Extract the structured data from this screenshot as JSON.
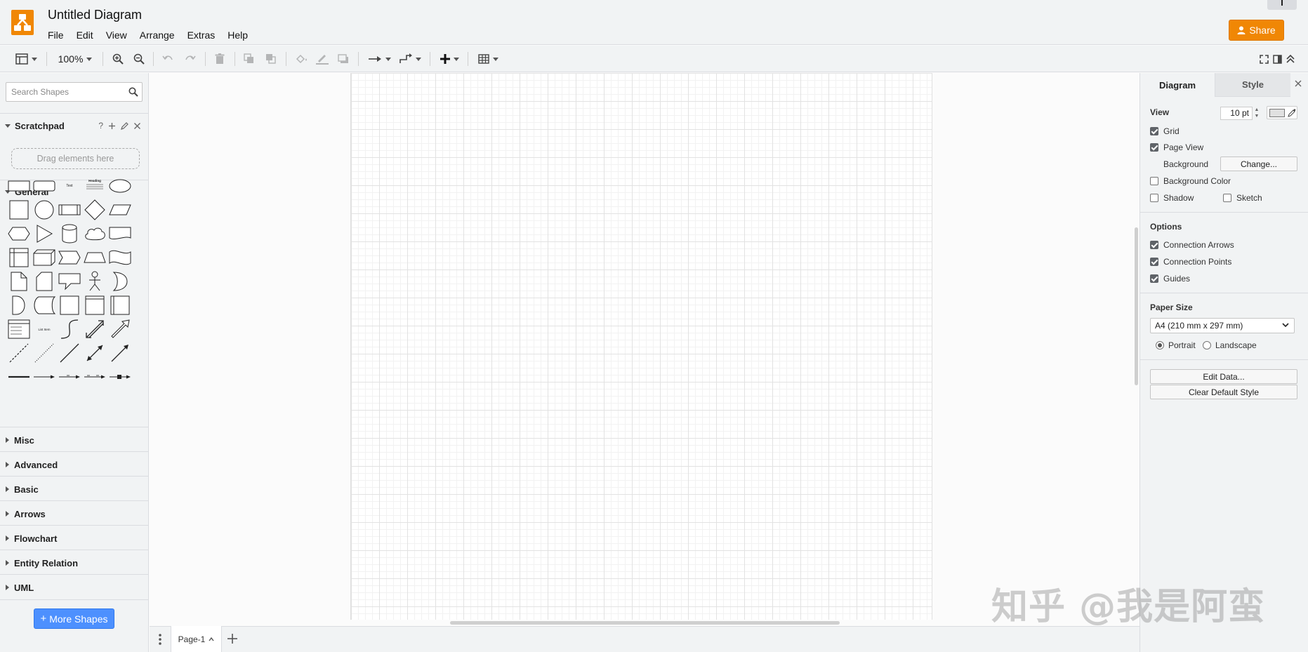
{
  "app": {
    "title": "Untitled Diagram",
    "share_label": "Share",
    "brand_color": "#f08705"
  },
  "menu": [
    "File",
    "Edit",
    "View",
    "Arrange",
    "Extras",
    "Help"
  ],
  "toolbar": {
    "zoom": "100%",
    "icons": [
      "view-icon",
      "zoom-in-icon",
      "zoom-out-icon",
      "undo-icon",
      "redo-icon",
      "delete-icon",
      "to-front-icon",
      "to-back-icon",
      "fill-color-icon",
      "line-color-icon",
      "shadow-icon",
      "connection-icon",
      "waypoints-icon",
      "insert-icon",
      "table-icon",
      "fullscreen-icon",
      "format-panel-icon",
      "collapse-icon"
    ]
  },
  "sidebar": {
    "search_placeholder": "Search Shapes",
    "scratchpad": {
      "label": "Scratchpad",
      "help": "?",
      "drag_hint": "Drag elements here"
    },
    "general_label": "General",
    "libraries": [
      "Misc",
      "Advanced",
      "Basic",
      "Arrows",
      "Flowchart",
      "Entity Relation",
      "UML"
    ],
    "more_shapes": "More Shapes",
    "shape_text": {
      "text": "Text",
      "heading": "Heading",
      "list_item": "List Item"
    }
  },
  "pages": {
    "current": "Page-1"
  },
  "format_panel": {
    "tabs": [
      "Diagram",
      "Style"
    ],
    "view_heading": "View",
    "grid_label": "Grid",
    "grid_checked": true,
    "grid_size": "10 pt",
    "page_view_label": "Page View",
    "page_view_checked": true,
    "background_label": "Background",
    "change_label": "Change...",
    "background_color_label": "Background Color",
    "shadow_label": "Shadow",
    "sketch_label": "Sketch",
    "options_heading": "Options",
    "connection_arrows_label": "Connection Arrows",
    "connection_points_label": "Connection Points",
    "guides_label": "Guides",
    "paper_size_heading": "Paper Size",
    "paper_size_value": "A4 (210 mm x 297 mm)",
    "portrait_label": "Portrait",
    "landscape_label": "Landscape",
    "orientation": "Portrait",
    "edit_data_label": "Edit Data...",
    "clear_style_label": "Clear Default Style"
  },
  "watermark": "知乎 @我是阿蛮"
}
